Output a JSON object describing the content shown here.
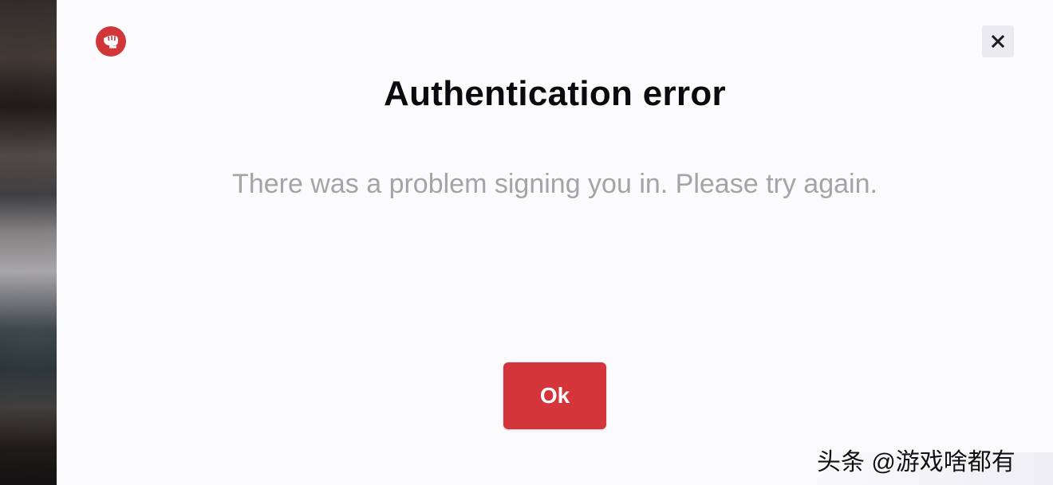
{
  "dialog": {
    "title": "Authentication error",
    "message": "There was a problem signing you in. Please try again.",
    "ok_label": "Ok",
    "close_icon": "close-icon",
    "logo_icon": "riot-fist-logo-icon"
  },
  "watermark": {
    "text": "头条 @游戏啥都有"
  },
  "colors": {
    "accent": "#d4353b",
    "logo": "#d13639",
    "background": "#fbfafd",
    "title": "#0b0b0d",
    "message": "#a4a3a8"
  }
}
